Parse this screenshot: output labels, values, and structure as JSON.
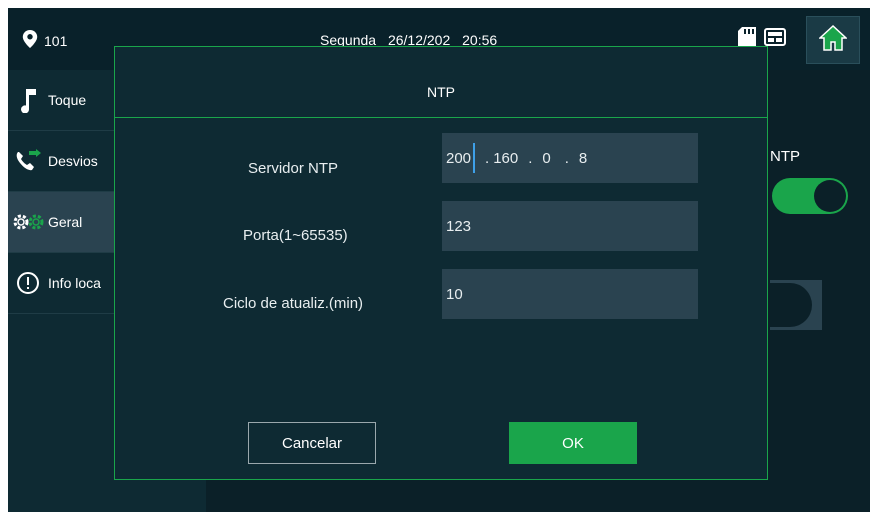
{
  "status_bar": {
    "room": "101",
    "day": "Segunda",
    "date": "26/12/202",
    "time": "20:56",
    "icons": [
      "sd-card-icon",
      "intercom-icon",
      "home-icon"
    ]
  },
  "sidebar": {
    "items": [
      {
        "label": "Toque",
        "icon": "music-note-icon",
        "active": false
      },
      {
        "label": "Desvios",
        "icon": "call-forward-icon",
        "active": false
      },
      {
        "label": "Geral",
        "icon": "gears-icon",
        "active": true
      },
      {
        "label": "Info loca",
        "icon": "info-icon",
        "active": false
      }
    ]
  },
  "background": {
    "ntp_label": "NTP",
    "ntp_toggle_on": true
  },
  "dialog": {
    "title": "NTP",
    "rows": [
      {
        "label": "Servidor NTP",
        "ip": [
          "200",
          "160",
          "0",
          "8"
        ]
      },
      {
        "label": "Porta(1~65535)",
        "value": "123"
      },
      {
        "label": "Ciclo de atualiz.(min)",
        "value": "10"
      }
    ],
    "cancel_label": "Cancelar",
    "ok_label": "OK"
  },
  "colors": {
    "accent": "#1aa54b",
    "background": "#0e2a33",
    "field": "#2a4350",
    "cursor": "#3ea0e8"
  }
}
